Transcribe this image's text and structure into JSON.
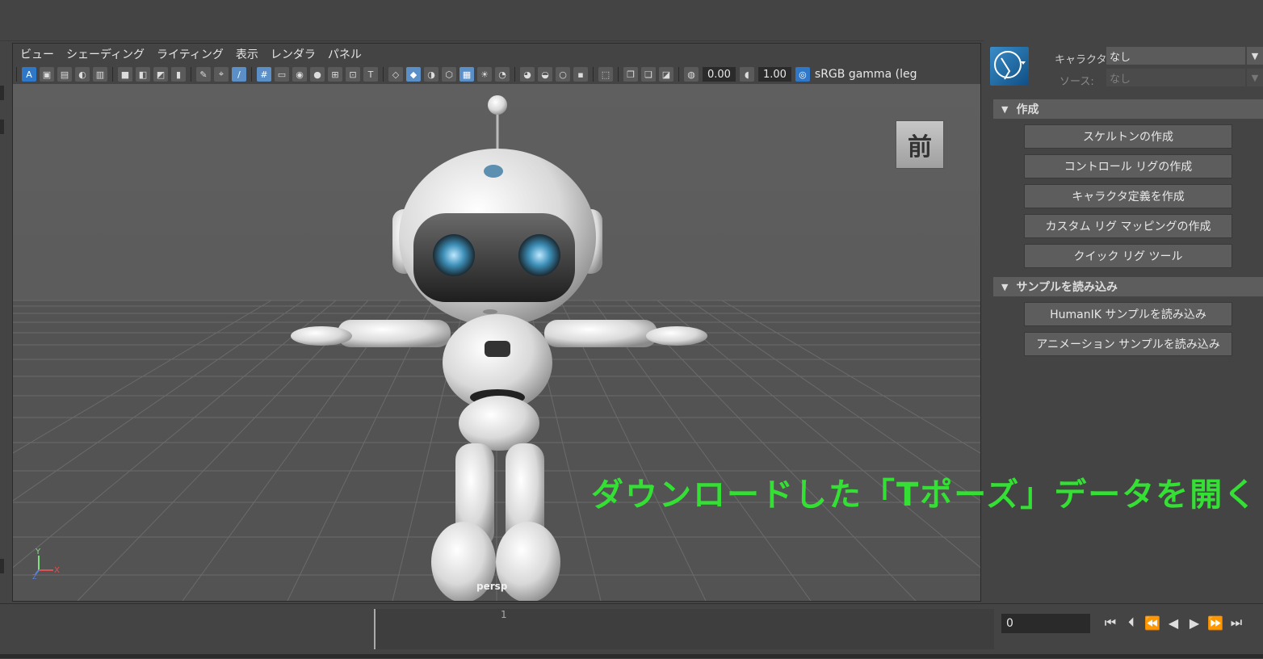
{
  "viewport": {
    "menu": [
      "ビュー",
      "シェーディング",
      "ライティング",
      "表示",
      "レンダラ",
      "パネル"
    ],
    "toolbar": {
      "exposure_value": "0.00",
      "gamma_value": "1.00",
      "color_management": "sRGB gamma (leg"
    },
    "view_cube_label": "前",
    "camera_label": "persp",
    "axis": {
      "y": "Y",
      "x": "X",
      "z": "Z"
    }
  },
  "right_panel": {
    "character_label": "キャラクタ:",
    "character_value": "なし",
    "source_label": "ソース:",
    "source_value": "なし",
    "sections": [
      {
        "title": "作成",
        "buttons": [
          "スケルトンの作成",
          "コントロール リグの作成",
          "キャラクタ定義を作成",
          "カスタム リグ マッピングの作成",
          "クイック リグ ツール"
        ]
      },
      {
        "title": "サンプルを読み込み",
        "buttons": [
          "HumanIK サンプルを読み込み",
          "アニメーション サンプルを読み込み"
        ]
      }
    ]
  },
  "timeline": {
    "frame_label": "1",
    "current_time": "0"
  },
  "overlay_caption": "ダウンロードした「Tポーズ」データを開く",
  "colors": {
    "caption": "#33e033",
    "active_icon": "#5a8fc7",
    "key_marker": "#e89a3c"
  }
}
